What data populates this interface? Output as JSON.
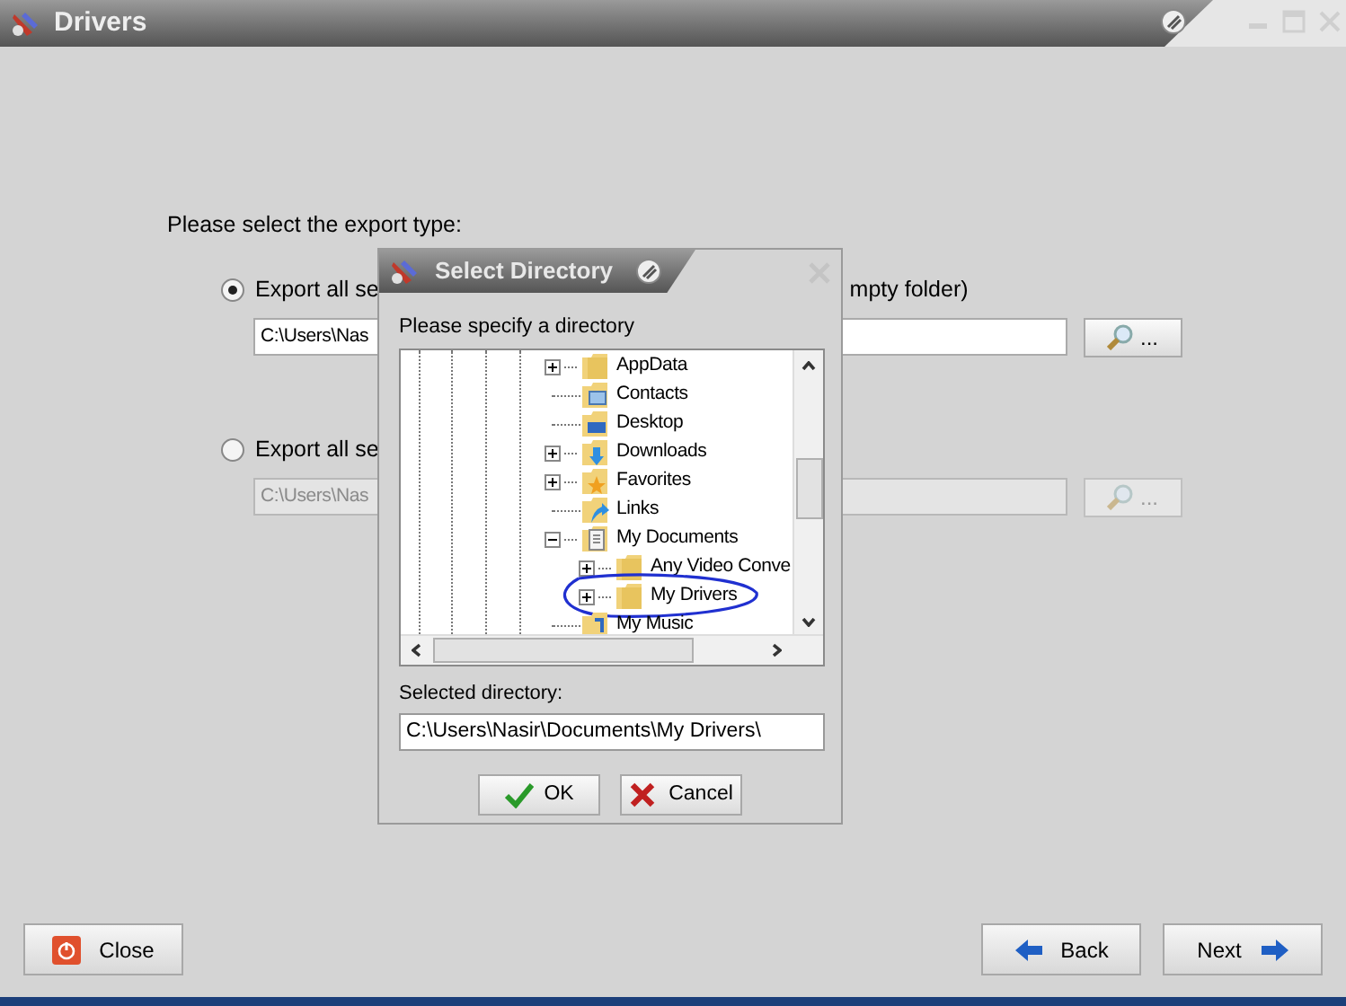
{
  "window": {
    "title": "Drivers"
  },
  "prompt": "Please select the export type:",
  "options": [
    {
      "label": "Export all se",
      "label_tail": "mpty folder)",
      "selected": true,
      "disabled": false,
      "path": "C:\\Users\\Nas",
      "browse": "..."
    },
    {
      "label": "Export all se",
      "selected": false,
      "disabled": true,
      "path": "C:\\Users\\Nas",
      "browse": "..."
    }
  ],
  "dialog": {
    "title": "Select Directory",
    "prompt": "Please specify a directory",
    "tree": [
      {
        "label": "AppData",
        "kind": "folder",
        "expanded": false
      },
      {
        "label": "Contacts",
        "kind": "contacts"
      },
      {
        "label": "Desktop",
        "kind": "desktop"
      },
      {
        "label": "Downloads",
        "kind": "downloads",
        "expanded": false
      },
      {
        "label": "Favorites",
        "kind": "favorites",
        "expanded": false
      },
      {
        "label": "Links",
        "kind": "links"
      },
      {
        "label": "My Documents",
        "kind": "documents",
        "expanded": true,
        "children": [
          {
            "label": "Any Video Conve",
            "kind": "folder",
            "expanded": false
          },
          {
            "label": "My Drivers",
            "kind": "folder",
            "expanded": false,
            "circled": true
          }
        ]
      },
      {
        "label": "My Music",
        "kind": "music"
      }
    ],
    "selected_label": "Selected directory:",
    "selected_value": "C:\\Users\\Nasir\\Documents\\My Drivers\\",
    "buttons": [
      {
        "label": "OK",
        "kind": "ok"
      },
      {
        "label": "Cancel",
        "kind": "cancel"
      }
    ]
  },
  "footer": [
    {
      "label": "Close",
      "kind": "close"
    },
    {
      "label": "Back",
      "kind": "back"
    },
    {
      "label": "Next",
      "kind": "next"
    }
  ]
}
